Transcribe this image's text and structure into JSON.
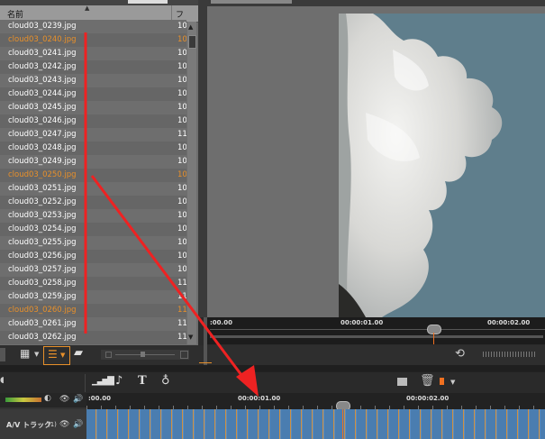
{
  "file_list": {
    "header_name": "名前",
    "header_col2": "フ",
    "rows": [
      {
        "name": "cloud03_0239.jpg",
        "size": "10",
        "highlight": false
      },
      {
        "name": "cloud03_0240.jpg",
        "size": "10",
        "highlight": true
      },
      {
        "name": "cloud03_0241.jpg",
        "size": "10",
        "highlight": false
      },
      {
        "name": "cloud03_0242.jpg",
        "size": "10",
        "highlight": false
      },
      {
        "name": "cloud03_0243.jpg",
        "size": "10",
        "highlight": false
      },
      {
        "name": "cloud03_0244.jpg",
        "size": "10",
        "highlight": false
      },
      {
        "name": "cloud03_0245.jpg",
        "size": "10",
        "highlight": false
      },
      {
        "name": "cloud03_0246.jpg",
        "size": "10",
        "highlight": false
      },
      {
        "name": "cloud03_0247.jpg",
        "size": "11",
        "highlight": false
      },
      {
        "name": "cloud03_0248.jpg",
        "size": "10",
        "highlight": false
      },
      {
        "name": "cloud03_0249.jpg",
        "size": "10",
        "highlight": false
      },
      {
        "name": "cloud03_0250.jpg",
        "size": "10",
        "highlight": true
      },
      {
        "name": "cloud03_0251.jpg",
        "size": "10",
        "highlight": false
      },
      {
        "name": "cloud03_0252.jpg",
        "size": "10",
        "highlight": false
      },
      {
        "name": "cloud03_0253.jpg",
        "size": "10",
        "highlight": false
      },
      {
        "name": "cloud03_0254.jpg",
        "size": "10",
        "highlight": false
      },
      {
        "name": "cloud03_0255.jpg",
        "size": "10",
        "highlight": false
      },
      {
        "name": "cloud03_0256.jpg",
        "size": "10",
        "highlight": false
      },
      {
        "name": "cloud03_0257.jpg",
        "size": "10",
        "highlight": false
      },
      {
        "name": "cloud03_0258.jpg",
        "size": "11",
        "highlight": false
      },
      {
        "name": "cloud03_0259.jpg",
        "size": "11",
        "highlight": false
      },
      {
        "name": "cloud03_0260.jpg",
        "size": "11",
        "highlight": true
      },
      {
        "name": "cloud03_0261.jpg",
        "size": "11",
        "highlight": false
      },
      {
        "name": "cloud03_0262.jpg",
        "size": "11",
        "highlight": false
      }
    ]
  },
  "preview": {
    "timecodes": [
      ":00.00",
      "00:00:01.00",
      "00:00:02.00"
    ]
  },
  "timeline": {
    "timecodes": [
      ":00.00",
      "00:00:01.00",
      "00:00:02.00"
    ],
    "track_label": "A/V トラック",
    "track_count": "(1)"
  },
  "colors": {
    "highlight_text": "#e8902a",
    "row_a": "#6e6e6e",
    "row_b": "#666666",
    "annotation_red": "#ee2222",
    "track_blue": "#4a7db0",
    "playhead_orange": "#f07020"
  },
  "icons": {
    "grid_view": "grid-icon",
    "list_view": "list-icon",
    "media_folder": "folder-icon",
    "loop": "loop-icon",
    "audio_levels": "level-bars-icon",
    "music": "music-note-icon",
    "text": "title-text-icon",
    "mic": "microphone-icon",
    "marker_clip": "clip-marker-icon",
    "trash": "trash-icon",
    "marker": "marker-icon"
  }
}
